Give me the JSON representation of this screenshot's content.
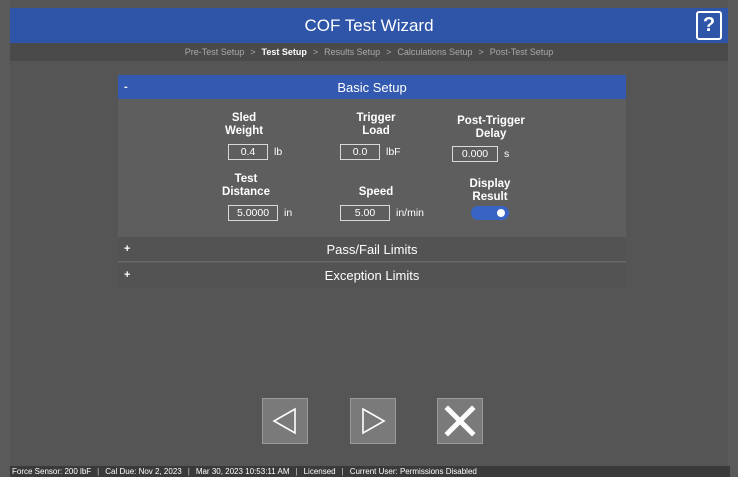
{
  "app": {
    "title": "COF Test Wizard",
    "help_label": "?"
  },
  "breadcrumb": {
    "items": [
      "Pre-Test Setup",
      "Test Setup",
      "Results Setup",
      "Calculations Setup",
      "Post-Test Setup"
    ],
    "active": "Test Setup",
    "separator": ">"
  },
  "basic_setup": {
    "header": "Basic Setup",
    "toggle": "-",
    "fields": {
      "sled_weight": {
        "label1": "Sled",
        "label2": "Weight",
        "value": "0.4",
        "unit": "lb"
      },
      "trigger_load": {
        "label1": "Trigger",
        "label2": "Load",
        "value": "0.0",
        "unit": "lbF"
      },
      "post_trigger_delay": {
        "label1": "Post-Trigger",
        "label2": "Delay",
        "value": "0.000",
        "unit": "s"
      },
      "test_distance": {
        "label1": "Test",
        "label2": "Distance",
        "value": "5.0000",
        "unit": "in"
      },
      "speed": {
        "label1": "Speed",
        "value": "5.00",
        "unit": "in/min"
      },
      "display_result": {
        "label1": "Display",
        "label2": "Result",
        "enabled": true
      }
    }
  },
  "pass_fail": {
    "header": "Pass/Fail Limits",
    "toggle": "+"
  },
  "exception": {
    "header": "Exception Limits",
    "toggle": "+"
  },
  "nav": {
    "back_icon": "triangle-left-icon",
    "next_icon": "triangle-right-icon",
    "cancel_icon": "close-x-icon"
  },
  "status": {
    "sensor": "Force Sensor: 200 lbF",
    "cal_due": "Cal Due: Nov 2, 2023",
    "datetime": "Mar 30, 2023 10:53:11 AM",
    "license": "Licensed",
    "user": "Current User: Permissions Disabled",
    "separator": "|"
  },
  "colors": {
    "accent": "#2f55a9",
    "background": "#555555",
    "panel": "#5e5e5e"
  }
}
